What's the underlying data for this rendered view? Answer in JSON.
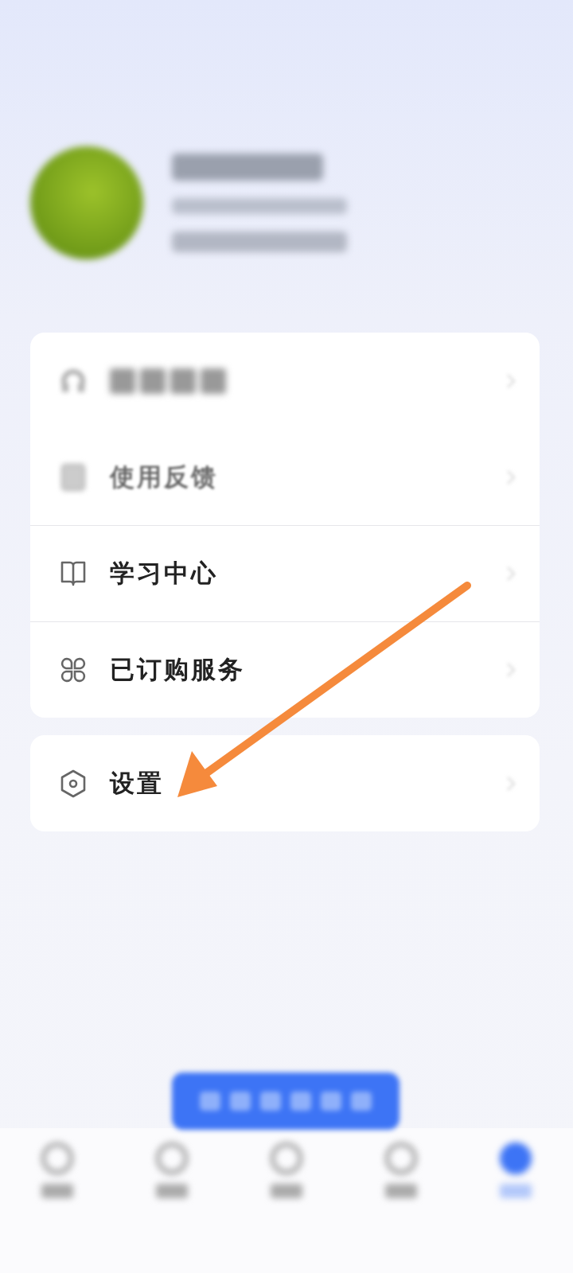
{
  "menu_groups": [
    {
      "items": [
        {
          "kind": "headset",
          "blurred": true,
          "divider": false
        },
        {
          "kind": "note",
          "label": "使用反馈",
          "blurred": true,
          "divider": false
        },
        {
          "kind": "book",
          "label": "学习中心",
          "blurred": false,
          "divider": true
        },
        {
          "kind": "grid",
          "label": "已订购服务",
          "blurred": false,
          "divider": true
        }
      ]
    },
    {
      "items": [
        {
          "kind": "hexagon",
          "label": "设置",
          "blurred": false,
          "divider": false
        }
      ]
    }
  ],
  "bottom_nav": {
    "items": [
      {
        "selected": false
      },
      {
        "selected": false
      },
      {
        "selected": false
      },
      {
        "selected": false
      },
      {
        "selected": true
      }
    ]
  }
}
